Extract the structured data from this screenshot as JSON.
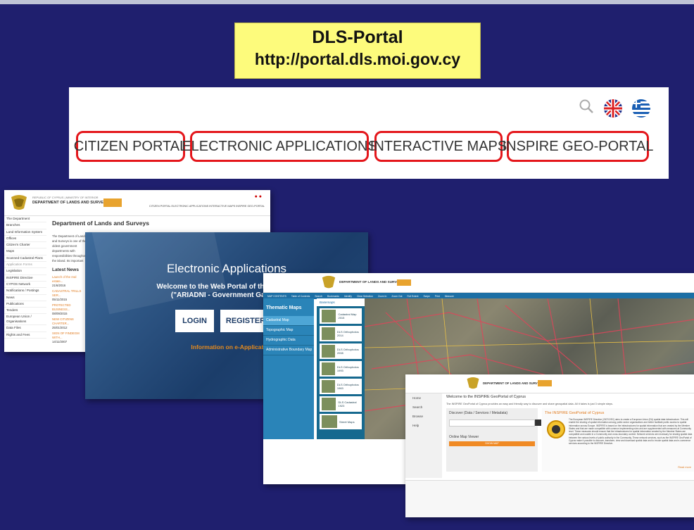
{
  "title_box": {
    "line1": "DLS-Portal",
    "line2": "http://portal.dls.moi.gov.cy"
  },
  "nav": {
    "items": [
      {
        "label": "CITIZEN PORTAL"
      },
      {
        "label": "ELECTRONIC APPLICATIONS"
      },
      {
        "label": "INTERACTIVE MAPS"
      },
      {
        "label": "INSPIRE GEO-PORTAL"
      }
    ],
    "highlight_color": "#e4161b"
  },
  "shot1": {
    "header_small": "REPUBLIC OF CYPRUS | MINISTRY OF INTERIOR",
    "header_name": "DEPARTMENT OF LANDS AND SURVEYS",
    "topnav": "CITIZEN PORTAL  ELECTRONIC APPLICATIONS  INTERACTIVE MAPS  INSPIRE GEO-PORTAL",
    "sidebar": [
      "The Department",
      "Branches",
      "Land Information System",
      "Offices",
      "Citizen's Charter",
      "Maps",
      "Scanned Cadastral Plans",
      "Application Forms",
      "Legislation",
      "INSPIRE Directive",
      "CYPOS Network",
      "Notifications / Postings",
      "News",
      "Publications",
      "Tenders",
      "European Union / Organisations",
      "Data Files",
      "Rights and Fees"
    ],
    "heading": "Department of Lands and Surveys",
    "body_text": "The Department of Lands and Surveys is one of the oldest government departments with responsibilities throughout the island. Its important contribution to the economic life of the country lies in the registration of immovable property and for the efficient service to organisations and individuals.",
    "news_heading": "Latest News",
    "news": [
      {
        "t": "Launch of the real estate...",
        "d": "21/6/2016"
      },
      {
        "t": "CADASTRAL TRILLS SER...",
        "d": "05/11/2015"
      },
      {
        "t": "PROTECTED BUSINESS...",
        "d": "08/09/2015"
      },
      {
        "t": "NEW CITIZENS CHARTER...",
        "d": "25/01/2012"
      },
      {
        "t": "SIGN OF FINDEGM WITH...",
        "d": "14/11/2007"
      }
    ]
  },
  "shot2": {
    "title": "Electronic Applications",
    "line1": "Welcome to the Web Portal of the Department",
    "line2": "(\"ARIADNI - Government Gateway\" Regis",
    "login": "LOGIN",
    "register": "REGISTER",
    "info": "Information on e-Applications and ARIADI"
  },
  "shot3": {
    "header_name": "DEPARTMENT OF LANDS AND SURVEYS",
    "toolbar_items": [
      "MAP CONTENTS",
      "Table of Contents",
      "Search",
      "Bookmarks",
      "Identify",
      "Clear Selection",
      "Zoom In",
      "Zoom Out",
      "Full Extent",
      "Swipe",
      "Print",
      "Measure"
    ],
    "panel_title": "Thematic Maps",
    "panel_items": [
      "Cadastral Map",
      "Topographic Map",
      "Hydrographic Data",
      "Administrative Boundary Map"
    ],
    "basemaps_label": "Basemaps",
    "thumbs": [
      "Cadastral Map 2015",
      "DLS Orthophotos 2014",
      "DLS Orthophotos 2008",
      "DLS Orthophotos 1993",
      "DLS Orthophotos 1963",
      "DLS Cadastral 1923",
      "Street Maps"
    ]
  },
  "shot4": {
    "header_name": "DEPARTMENT OF LANDS AND SURVEYS",
    "welcome": "Welcome to the INSPIRE GeoPortal of Cyprus",
    "intro": "The INSPIRE GeoPortal of Cyprus provides an easy and friendly way to discover and share geospatial data. All it takes is just 3 simple steps.",
    "nav": [
      "Home",
      "Search",
      "Browse",
      "Help"
    ],
    "discover": "Discover (Data / Services / Metadata)",
    "viewer": "Online Map Viewer",
    "viewer_btn": "SHOW MAP",
    "right_title": "The INSPIRE GeoPortal of Cyprus",
    "right_text": "The European INSPIRE Directive (2007/2/EC) aims to create a European Union (EU) spatial data infrastructure. This will enable the sharing of spatial information among public sector organisations and better facilitate public access to spatial information across Europe. INSPIRE is based on the infrastructures for spatial information that are created by the Member States and that are made compatible with common implementing rules and are supplemented with measures at Community level. These measures should ensure that the infrastructures for spatial information created by the Member States are compatible and usable in a Community and cross-boundary context. Network services are necessary for sharing spatial data between the various levels of public authority in the Community. These network services, such as the INSPIRE GeoPortal of Cyprus make it possible to discover, transform, view and download spatial data and to invoke spatial data and e-commerce services according to the INSPIRE Directive.",
    "read_more": "Read more"
  }
}
